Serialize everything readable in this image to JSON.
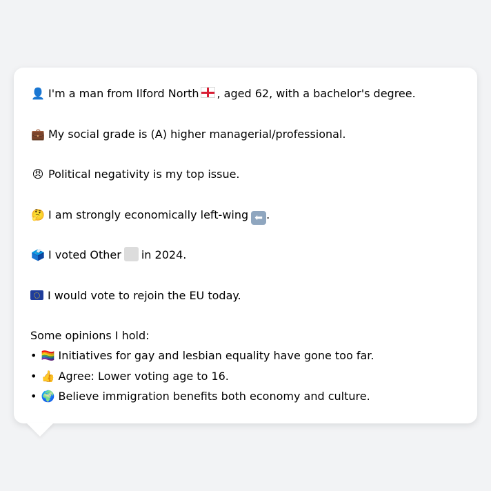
{
  "bio": {
    "line1": {
      "icon": "👤",
      "before_flag": "I'm a man from Ilford North",
      "after_flag": ", aged 62, with a bachelor's degree."
    },
    "line2": {
      "icon": "💼",
      "text": "My social grade is (A) higher managerial/professional."
    },
    "line3": {
      "icon": "😠",
      "text": "Political negativity is my top issue."
    },
    "line4": {
      "icon": "🤔",
      "text": "I am strongly economically left-wing",
      "arrow": "⬅",
      "end": "."
    },
    "line5": {
      "icon": "🗳️",
      "before": "I voted Other",
      "after": "in 2024."
    },
    "line6": {
      "icon_name": "eu-flag-icon",
      "text": "I would vote to rejoin the EU today."
    }
  },
  "opinions": {
    "heading": "Some opinions I hold:",
    "bullet": "•",
    "items": [
      {
        "icon": "🏳️‍🌈",
        "text": "Initiatives for gay and lesbian equality have gone too far."
      },
      {
        "icon": "👍",
        "text": "Agree: Lower voting age to 16."
      },
      {
        "icon": "🌍",
        "text": "Believe immigration benefits both economy and culture."
      }
    ]
  }
}
